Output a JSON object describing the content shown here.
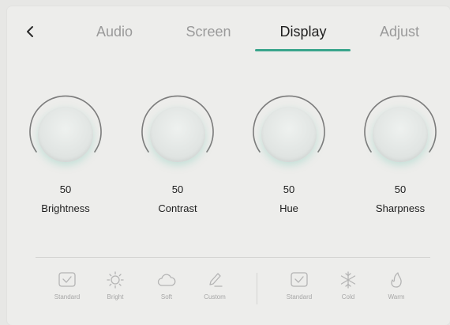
{
  "nav": {
    "back_icon": "chevron-left-icon",
    "tabs": [
      {
        "label": "Audio",
        "active": false
      },
      {
        "label": "Screen",
        "active": false
      },
      {
        "label": "Display",
        "active": true
      },
      {
        "label": "Adjust",
        "active": false
      }
    ]
  },
  "colors": {
    "accent": "#3aa58c",
    "active_text": "#1f1f1f",
    "inactive_text": "#9a9a9a"
  },
  "knobs": [
    {
      "label": "Brightness",
      "value": "50"
    },
    {
      "label": "Contrast",
      "value": "50"
    },
    {
      "label": "Hue",
      "value": "50"
    },
    {
      "label": "Sharpness",
      "value": "50"
    }
  ],
  "presets": {
    "mode": [
      {
        "label": "Standard",
        "icon": "checkbox-icon"
      },
      {
        "label": "Bright",
        "icon": "sun-icon"
      },
      {
        "label": "Soft",
        "icon": "cloud-icon"
      },
      {
        "label": "Custom",
        "icon": "pencil-icon"
      }
    ],
    "temperature": [
      {
        "label": "Standard",
        "icon": "checkbox-icon"
      },
      {
        "label": "Cold",
        "icon": "snowflake-icon"
      },
      {
        "label": "Warm",
        "icon": "flame-icon"
      }
    ]
  }
}
